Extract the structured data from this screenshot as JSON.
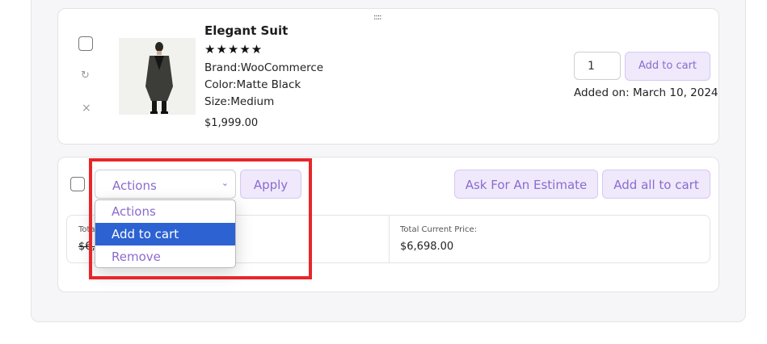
{
  "item": {
    "title": "Elegant Suit",
    "rating_stars": "★★★★★",
    "brand": "Brand:WooCommerce",
    "color": "Color:Matte Black",
    "size": "Size:Medium",
    "price": "$1,999.00",
    "quantity": "1",
    "add_to_cart_label": "Add to cart",
    "added_on": "Added on: March 10, 2024",
    "drag_handle": "::::",
    "move_icon": "↻",
    "remove_icon": "×"
  },
  "bulk": {
    "select_value": "Actions",
    "chevron": "⌄",
    "apply_label": "Apply",
    "estimate_label": "Ask For An Estimate",
    "add_all_label": "Add all to cart",
    "dropdown_options": [
      "Actions",
      "Add to cart",
      "Remove"
    ],
    "selected_option_index": 1
  },
  "totals": {
    "left_label": "Tota",
    "left_value": "$6,",
    "right_label": "Total Current Price:",
    "right_value": "$6,698.00"
  },
  "colors": {
    "accent": "#8a6bd0",
    "accent_bg": "#efe9fb",
    "highlight_box": "#e8262a",
    "selected_option": "#2c62d2"
  }
}
